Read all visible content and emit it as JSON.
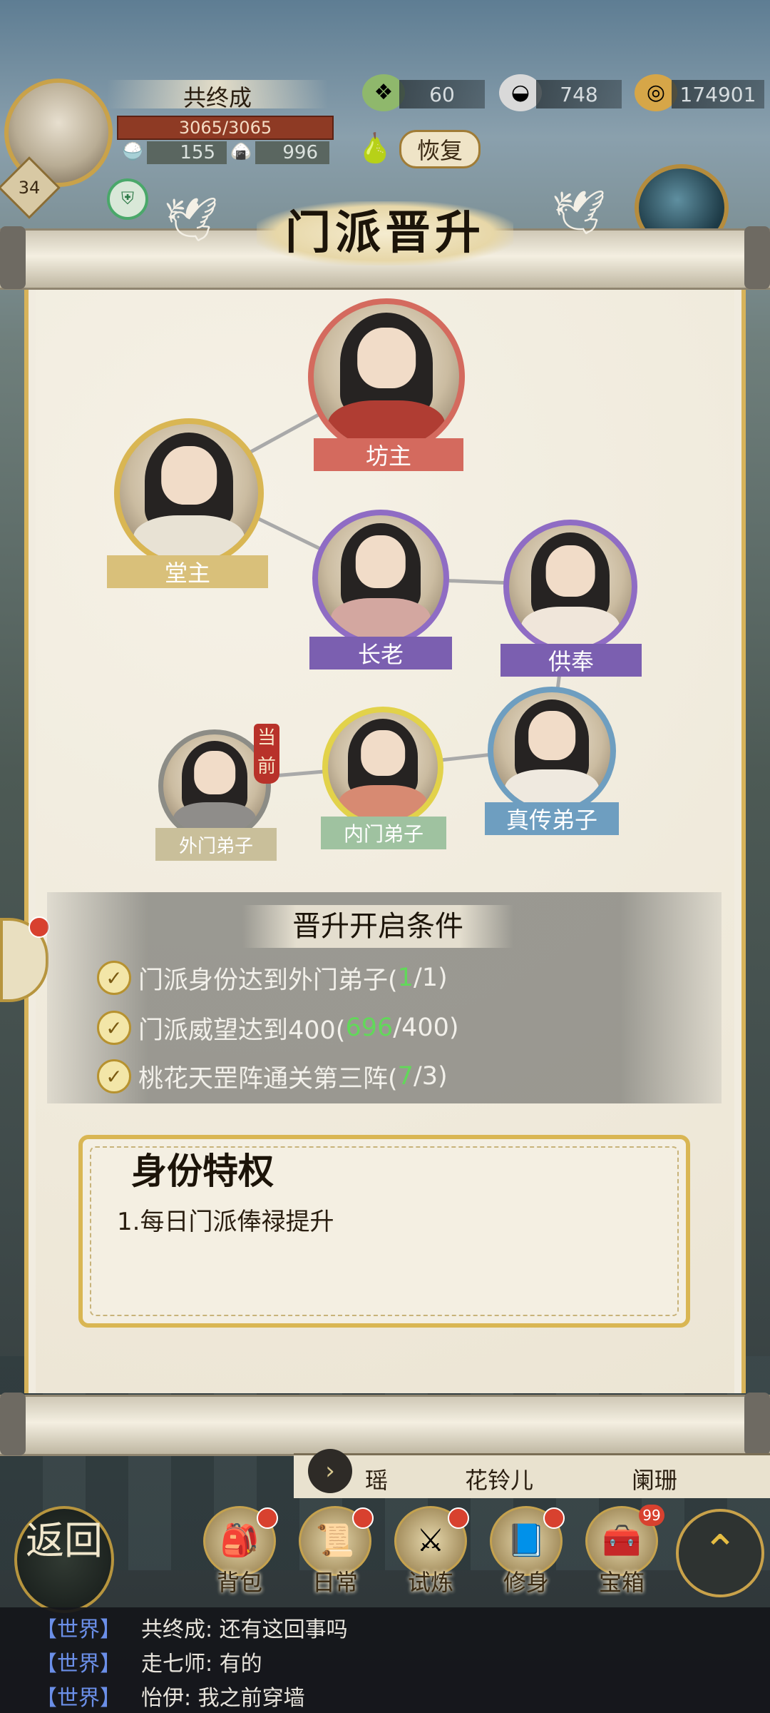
{
  "player": {
    "name": "共终成",
    "level": "34",
    "hp": "3065/3065",
    "stat_1": "155",
    "stat_2": "996"
  },
  "resources": {
    "jade": "60",
    "silver": "748",
    "coins": "174901",
    "recover_label": "恢复"
  },
  "scroll": {
    "title": "门派晋升"
  },
  "ranks": {
    "fangzhu": "坊主",
    "tangzhu": "堂主",
    "zhanglao": "长老",
    "gongfeng": "供奉",
    "waimen": "外门弟子",
    "neimen": "内门弟子",
    "zhenchuan": "真传弟子",
    "current_tag": "当前"
  },
  "conditions": {
    "title": "晋升开启条件",
    "items": [
      {
        "prefix": "门派身份达到外门弟子(",
        "progress": "1",
        "suffix": "/1)"
      },
      {
        "prefix": "门派威望达到400(",
        "progress": "696",
        "suffix": "/400)"
      },
      {
        "prefix": "桃花天罡阵通关第三阵(",
        "progress": "7",
        "suffix": "/3)"
      }
    ]
  },
  "privilege": {
    "title": "身份特权",
    "line": "1.每日门派俸禄提升"
  },
  "tabs": [
    "瑶",
    "花铃儿",
    "阑珊"
  ],
  "bottom_menu": {
    "back": "返回",
    "bag": "背包",
    "daily": "日常",
    "trial": "试炼",
    "cultivate": "修身",
    "chest": "宝箱",
    "chest_badge": "99"
  },
  "chat": [
    {
      "channel": "【世界】",
      "text": "共终成: 还有这回事吗"
    },
    {
      "channel": "【世界】",
      "text": "走七师: 有的"
    },
    {
      "channel": "【世界】",
      "text": "怡伊: 我之前穿墙"
    }
  ],
  "colors": {
    "progress_green": "#62d85a",
    "fangzhu_ribbon": "#d46a5e",
    "gold_ribbon": "#d9c07a",
    "purple_ribbon": "#7b5fb0",
    "blue_ribbon": "#6e9ec0",
    "gray_ribbon": "#c9bf9a"
  }
}
